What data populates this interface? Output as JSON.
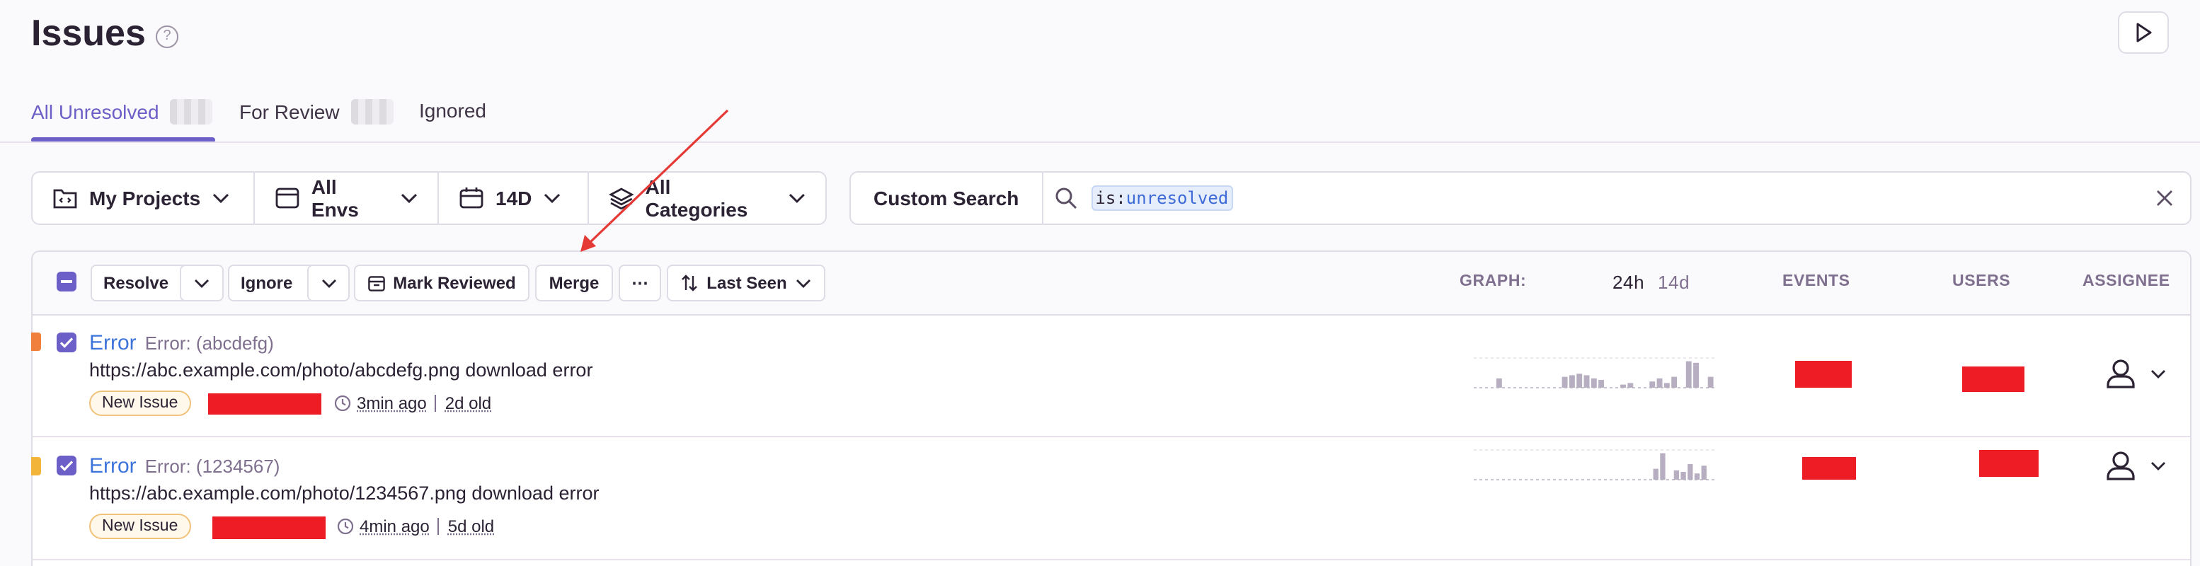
{
  "page": {
    "title": "Issues",
    "help_icon": "question-circle-icon",
    "play_icon": "play-icon"
  },
  "tabs": [
    {
      "label": "All Unresolved",
      "active": true
    },
    {
      "label": "For Review",
      "active": false
    },
    {
      "label": "Ignored",
      "active": false
    }
  ],
  "filters": {
    "projects": {
      "label": "My Projects",
      "icon": "project-icon"
    },
    "envs": {
      "label": "All Envs",
      "icon": "window-icon"
    },
    "date": {
      "label": "14D",
      "icon": "calendar-icon"
    },
    "categories": {
      "label": "All Categories",
      "icon": "layers-icon"
    }
  },
  "search": {
    "custom_label": "Custom Search",
    "query_key": "is:",
    "query_value": "unresolved",
    "icon": "search-icon",
    "clear_icon": "close-icon"
  },
  "toolbar": {
    "resolve": "Resolve",
    "ignore": "Ignore",
    "mark_reviewed": "Mark Reviewed",
    "merge": "Merge",
    "more": "⋯",
    "sort": "Last Seen"
  },
  "columns": {
    "graph": "GRAPH:",
    "period_24h": "24h",
    "period_14d": "14d",
    "events": "EVENTS",
    "users": "USERS",
    "assignee": "ASSIGNEE"
  },
  "issues": [
    {
      "type": "Error",
      "message": "Error: (abcdefg)",
      "url": "https://abc.example.com/photo/abcdefg.png download error",
      "badge": "New Issue",
      "last_seen": "3min ago",
      "age": "2d old",
      "level_color": "#f0803c",
      "checked": true,
      "spark": [
        0,
        0,
        0,
        0.3,
        0,
        0,
        0,
        0,
        0,
        0,
        0,
        0,
        0.35,
        0.4,
        0.45,
        0.4,
        0.3,
        0.25,
        0,
        0,
        0.1,
        0.15,
        0,
        0,
        0.2,
        0.3,
        0.15,
        0.35,
        0,
        0.85,
        0.8,
        0,
        0.35
      ]
    },
    {
      "type": "Error",
      "message": "Error: (1234567)",
      "url": "https://abc.example.com/photo/1234567.png download error",
      "badge": "New Issue",
      "last_seen": "4min ago",
      "age": "5d old",
      "level_color": "#f2b53a",
      "checked": true,
      "spark": [
        0,
        0,
        0,
        0,
        0,
        0,
        0,
        0,
        0,
        0,
        0,
        0,
        0,
        0,
        0,
        0,
        0,
        0,
        0,
        0,
        0,
        0,
        0,
        0,
        0,
        0,
        0.35,
        0.85,
        0,
        0.3,
        0.25,
        0.5,
        0.2,
        0.45,
        0
      ]
    }
  ]
}
